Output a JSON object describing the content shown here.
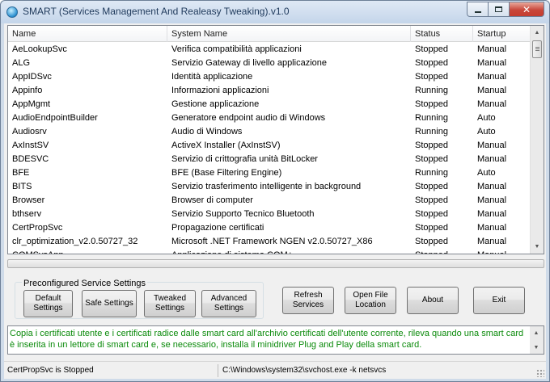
{
  "window": {
    "title": "SMART (Services Management And Realeasy Tweaking).v1.0",
    "icon": "gear-globe-icon",
    "minimize_glyph": "minimize-icon",
    "maximize_glyph": "maximize-icon",
    "close_label": "✕"
  },
  "table": {
    "headers": [
      "Name",
      "System Name",
      "Status",
      "Startup"
    ],
    "rows": [
      [
        "AeLookupSvc",
        "Verifica compatibilità applicazioni",
        "Stopped",
        "Manual"
      ],
      [
        "ALG",
        "Servizio Gateway di livello applicazione",
        "Stopped",
        "Manual"
      ],
      [
        "AppIDSvc",
        "Identità applicazione",
        "Stopped",
        "Manual"
      ],
      [
        "Appinfo",
        "Informazioni applicazioni",
        "Running",
        "Manual"
      ],
      [
        "AppMgmt",
        "Gestione applicazione",
        "Stopped",
        "Manual"
      ],
      [
        "AudioEndpointBuilder",
        "Generatore endpoint audio di Windows",
        "Running",
        "Auto"
      ],
      [
        "Audiosrv",
        "Audio di Windows",
        "Running",
        "Auto"
      ],
      [
        "AxInstSV",
        "ActiveX Installer (AxInstSV)",
        "Stopped",
        "Manual"
      ],
      [
        "BDESVC",
        "Servizio di crittografia unità BitLocker",
        "Stopped",
        "Manual"
      ],
      [
        "BFE",
        "BFE (Base Filtering Engine)",
        "Running",
        "Auto"
      ],
      [
        "BITS",
        "Servizio trasferimento intelligente in background",
        "Stopped",
        "Manual"
      ],
      [
        "Browser",
        "Browser di computer",
        "Stopped",
        "Manual"
      ],
      [
        "bthserv",
        "Servizio Supporto Tecnico Bluetooth",
        "Stopped",
        "Manual"
      ],
      [
        "CertPropSvc",
        "Propagazione certificati",
        "Stopped",
        "Manual"
      ],
      [
        "clr_optimization_v2.0.50727_32",
        "Microsoft .NET Framework NGEN v2.0.50727_X86",
        "Stopped",
        "Manual"
      ],
      [
        "COMSysApp",
        "Applicazione di sistema COM+",
        "Stopped",
        "Manual"
      ]
    ]
  },
  "preconfigured": {
    "group_label": "Preconfigured Service Settings",
    "default_label": "Default Settings",
    "safe_label": "Safe Settings",
    "tweaked_label": "Tweaked Settings",
    "advanced_label": "Advanced Settings"
  },
  "actions": {
    "refresh_label": "Refresh Services",
    "open_file_label": "Open File Location",
    "about_label": "About",
    "exit_label": "Exit"
  },
  "description": "Copia i certificati utente e i certificati radice dalle smart card all'archivio certificati dell'utente corrente, rileva quando una smart card è inserita in un lettore di smart card e, se necessario, installa il minidriver Plug and Play della smart card.",
  "status": {
    "message": "CertPropSvc is Stopped",
    "path": "C:\\Windows\\system32\\svchost.exe -k netsvcs"
  },
  "colors": {
    "description_text": "#0a8a0a",
    "close_button": "#c9473a"
  }
}
